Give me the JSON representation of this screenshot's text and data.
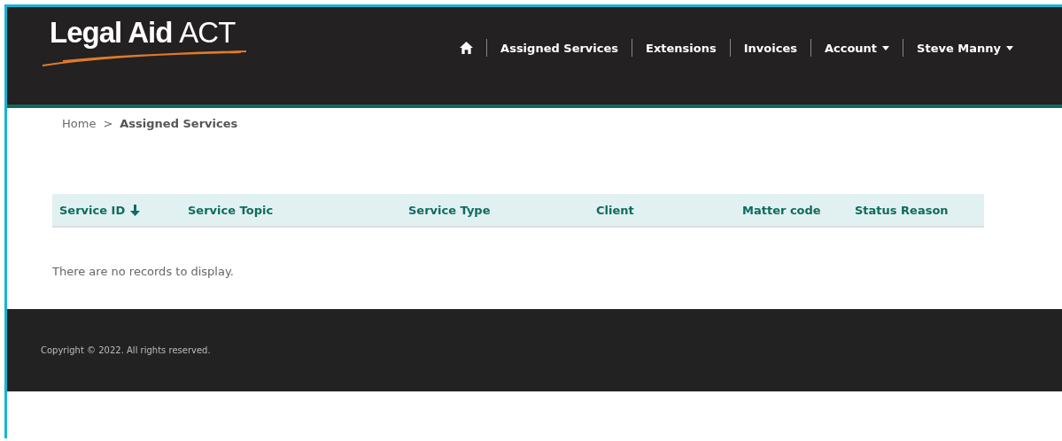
{
  "logo": {
    "bold": "Legal Aid",
    "light": "ACT"
  },
  "nav": [
    {
      "kind": "home"
    },
    {
      "kind": "link",
      "label": "Assigned Services"
    },
    {
      "kind": "link",
      "label": "Extensions"
    },
    {
      "kind": "link",
      "label": "Invoices"
    },
    {
      "kind": "dropdown",
      "label": "Account"
    },
    {
      "kind": "dropdown",
      "label": "Steve Manny"
    }
  ],
  "breadcrumb": [
    {
      "label": "Home",
      "current": false
    },
    {
      "label": "Assigned Services",
      "current": true
    }
  ],
  "breadcrumb_separator": ">",
  "table": {
    "columns": [
      {
        "label": "Service ID",
        "sorted_descending": true
      },
      {
        "label": "Service Topic",
        "sorted_descending": false
      },
      {
        "label": "Service Type",
        "sorted_descending": false
      },
      {
        "label": "Client",
        "sorted_descending": false
      },
      {
        "label": "Matter code",
        "sorted_descending": false
      },
      {
        "label": "Status Reason",
        "sorted_descending": false
      }
    ],
    "empty_message": "There are no records to display."
  },
  "footer": {
    "copyright": "Copyright © 2022. All rights reserved."
  }
}
